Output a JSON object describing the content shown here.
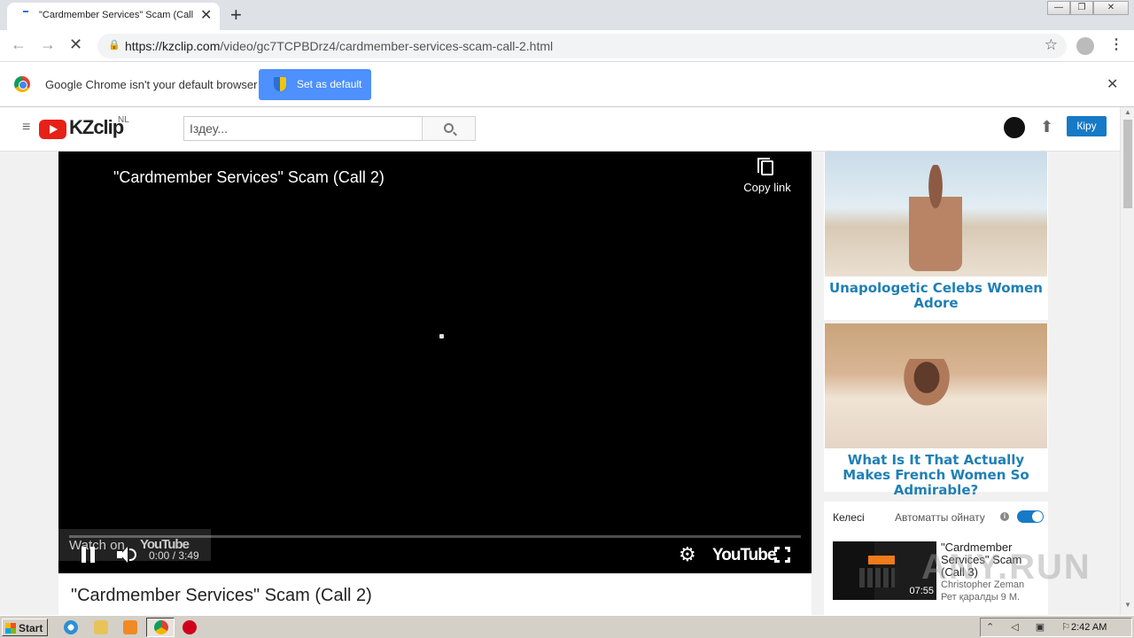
{
  "browser": {
    "tab_title": "\"Cardmember Services\" Scam (Call 2",
    "tab_close": "✕",
    "new_tab": "+",
    "url_domain": "https://kzclip.com",
    "url_path": "/video/gc7TCPBDrz4/cardmember-services-scam-call-2.html",
    "back_icon": "←",
    "forward_icon": "→",
    "stop_icon": "✕",
    "star_icon": "☆",
    "menu_icon": "⋮",
    "win_min": "—",
    "win_restore": "❐",
    "win_close": "✕"
  },
  "infobar": {
    "message": "Google Chrome isn't your default browser",
    "button": "Set as default",
    "close": "✕"
  },
  "site": {
    "logo_text": "KZclip",
    "region": "NL",
    "search_placeholder": "Іздеу...",
    "login_button": "Кіру",
    "menu_icon": "≡",
    "upload_icon": "⬆"
  },
  "player": {
    "title": "\"Cardmember Services\" Scam (Call 2)",
    "copy_link": "Copy link",
    "watch_on": "Watch on",
    "watch_brand": "YouTube",
    "time": "0:00 / 3:49",
    "settings_icon": "⚙",
    "brand": "YouTube",
    "progress": 0
  },
  "video_title": "\"Cardmember Services\" Scam (Call 2)",
  "ads": [
    {
      "caption": "Unapologetic Celebs Women Adore"
    },
    {
      "caption": "What Is It That Actually Makes French Women So Admirable?"
    }
  ],
  "upnext": {
    "label": "Келесі",
    "autoplay": "Автоматты ойнату",
    "info": "i",
    "autoplay_on": true,
    "video_title": "\"Cardmember Services\" Scam (Call 3)",
    "duration": "07:55",
    "channel": "Christopher Zeman",
    "views": "Рет қаралды 9 М."
  },
  "watermark": "ANY.RUN",
  "taskbar": {
    "start": "Start",
    "tray_icons": "⌃ ◁ ▣ ⚐",
    "clock": "2:42 AM"
  }
}
